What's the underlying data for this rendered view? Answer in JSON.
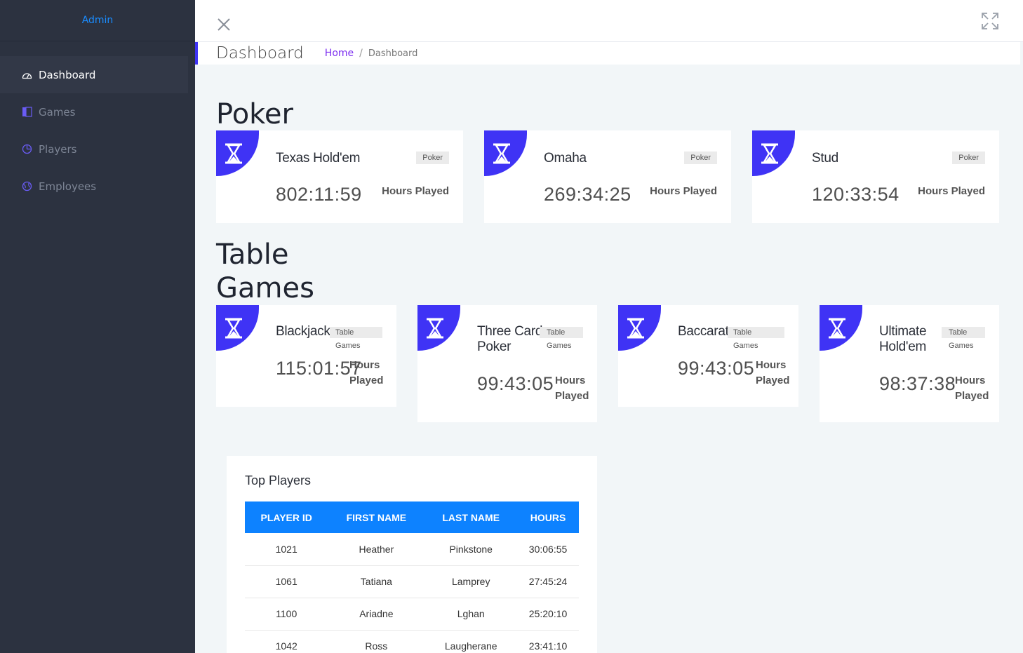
{
  "sidebar": {
    "brand": "Admin",
    "items": [
      {
        "label": "Dashboard",
        "icon": "dashboard-gauge-icon",
        "active": true
      },
      {
        "label": "Games",
        "icon": "book-icon",
        "active": false
      },
      {
        "label": "Players",
        "icon": "pie-chart-icon",
        "active": false
      },
      {
        "label": "Employees",
        "icon": "globe-icon",
        "active": false
      }
    ]
  },
  "header": {
    "page_title": "Dashboard",
    "breadcrumb": {
      "home": "Home",
      "separator": "/",
      "current": "Dashboard"
    }
  },
  "sections": {
    "poker": "Poker",
    "table_games_line1": "Table",
    "table_games_line2": "Games"
  },
  "poker_cards": [
    {
      "name": "Texas Hold'em",
      "tag": "Poker",
      "value": "802:11:59",
      "unit": "Hours Played"
    },
    {
      "name": "Omaha",
      "tag": "Poker",
      "value": "269:34:25",
      "unit": "Hours Played"
    },
    {
      "name": "Stud",
      "tag": "Poker",
      "value": "120:33:54",
      "unit": "Hours Played"
    }
  ],
  "table_cards": [
    {
      "name": "Blackjack",
      "tag_line1": "Table",
      "tag_line2": "Games",
      "value": "115:01:57",
      "unit_line1": "Hours",
      "unit_line2": "Played"
    },
    {
      "name_line1": "Three Card",
      "name_line2": "Poker",
      "tag_line1": "Table",
      "tag_line2": "Games",
      "value": "99:43:05",
      "unit_line1": "Hours",
      "unit_line2": "Played"
    },
    {
      "name": "Baccarat",
      "tag_line1": "Table",
      "tag_line2": "Games",
      "value": "99:43:05",
      "unit_line1": "Hours",
      "unit_line2": "Played"
    },
    {
      "name_line1": "Ultimate",
      "name_line2": "Hold'em",
      "tag_line1": "Table",
      "tag_line2": "Games",
      "value": "98:37:38",
      "unit_line1": "Hours",
      "unit_line2": "Played"
    }
  ],
  "top_players": {
    "title": "Top Players",
    "columns": [
      "PLAYER ID",
      "FIRST NAME",
      "LAST NAME",
      "HOURS"
    ],
    "rows": [
      [
        "1021",
        "Heather",
        "Pinkstone",
        "30:06:55"
      ],
      [
        "1061",
        "Tatiana",
        "Lamprey",
        "27:45:24"
      ],
      [
        "1100",
        "Ariadne",
        "Lghan",
        "25:20:10"
      ],
      [
        "1042",
        "Ross",
        "Laugherane",
        "23:41:10"
      ]
    ]
  },
  "colors": {
    "accent": "#3f33f5",
    "table_header": "#0d82ff",
    "sidebar_bg": "#2c3240",
    "brand": "#1a8cff"
  }
}
